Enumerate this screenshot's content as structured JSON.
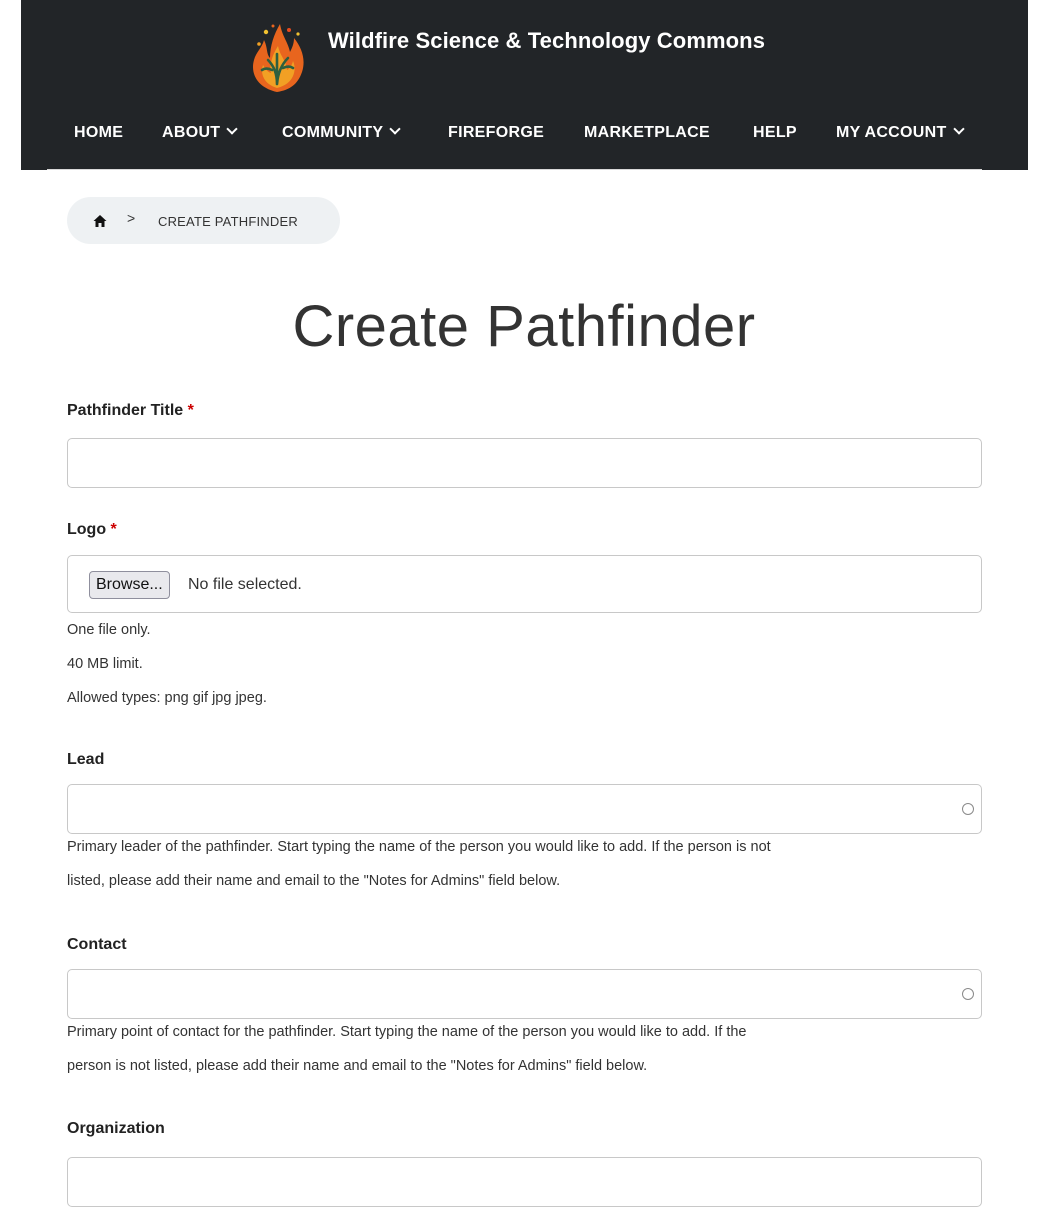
{
  "header": {
    "site_title": "Wildfire Science & Technology Commons",
    "logo_icon": "flame-tree-logo",
    "background_color": "#222528"
  },
  "nav": {
    "items": [
      {
        "label": "HOME",
        "has_dropdown": false
      },
      {
        "label": "ABOUT",
        "has_dropdown": true
      },
      {
        "label": "COMMUNITY",
        "has_dropdown": true
      },
      {
        "label": "FIREFORGE",
        "has_dropdown": false
      },
      {
        "label": "MARKETPLACE",
        "has_dropdown": false
      },
      {
        "label": "HELP",
        "has_dropdown": false
      },
      {
        "label": "MY ACCOUNT",
        "has_dropdown": true
      }
    ]
  },
  "breadcrumb": {
    "home_icon": "home-icon",
    "separator": ">",
    "current": "CREATE PATHFINDER"
  },
  "page": {
    "title": "Create Pathfinder"
  },
  "form": {
    "required_marker": "*",
    "required_color": "#cc0000",
    "title_field": {
      "label": "Pathfinder Title",
      "value": "",
      "required": true
    },
    "logo_field": {
      "label": "Logo",
      "required": true,
      "browse_label": "Browse...",
      "status": "No file selected.",
      "help": [
        "One file only.",
        "40 MB limit.",
        "Allowed types: png gif jpg jpeg."
      ]
    },
    "lead_field": {
      "label": "Lead",
      "value": "",
      "help_line1": "Primary leader of the pathfinder. Start typing the name of the person you would like to add. If the person is not",
      "help_line2": "listed, please add their name and email to the \"Notes for Admins\" field below."
    },
    "contact_field": {
      "label": "Contact",
      "value": "",
      "help_line1": "Primary point of contact for the pathfinder. Start typing the name of the person you would like to add. If the",
      "help_line2": "person is not listed, please add their name and email to the \"Notes for Admins\" field below."
    },
    "organization_field": {
      "label": "Organization",
      "value": ""
    }
  }
}
